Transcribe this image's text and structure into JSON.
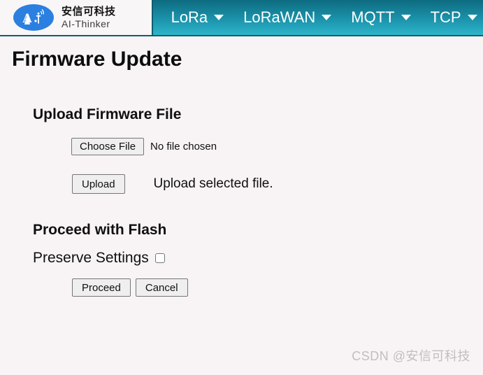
{
  "brand": {
    "logo_icon": "ai-thinker-logo-icon",
    "logo_glyph": "A.i",
    "name_cn": "安信可科技",
    "name_en": "AI-Thinker",
    "logo_color": "#2b7fe0"
  },
  "nav": {
    "caret_icon": "chevron-down-icon",
    "items": [
      {
        "label": "LoRa"
      },
      {
        "label": "LoRaWAN"
      },
      {
        "label": "MQTT"
      },
      {
        "label": "TCP"
      }
    ]
  },
  "page": {
    "title": "Firmware Update"
  },
  "upload_section": {
    "heading": "Upload Firmware File",
    "choose_file_label": "Choose File",
    "file_status": "No file chosen",
    "upload_label": "Upload",
    "upload_hint": "Upload selected file."
  },
  "flash_section": {
    "heading": "Proceed with Flash",
    "preserve_label": "Preserve Settings",
    "preserve_checked": false,
    "proceed_label": "Proceed",
    "cancel_label": "Cancel"
  },
  "watermark": {
    "text": "CSDN @安信可科技"
  },
  "colors": {
    "nav_top": "#0d6b80",
    "nav_bottom": "#2db5ca",
    "nav_border": "#0c5f70",
    "page_background": "#f8f4f5",
    "text": "#101010",
    "watermark": "#c2bec0"
  }
}
